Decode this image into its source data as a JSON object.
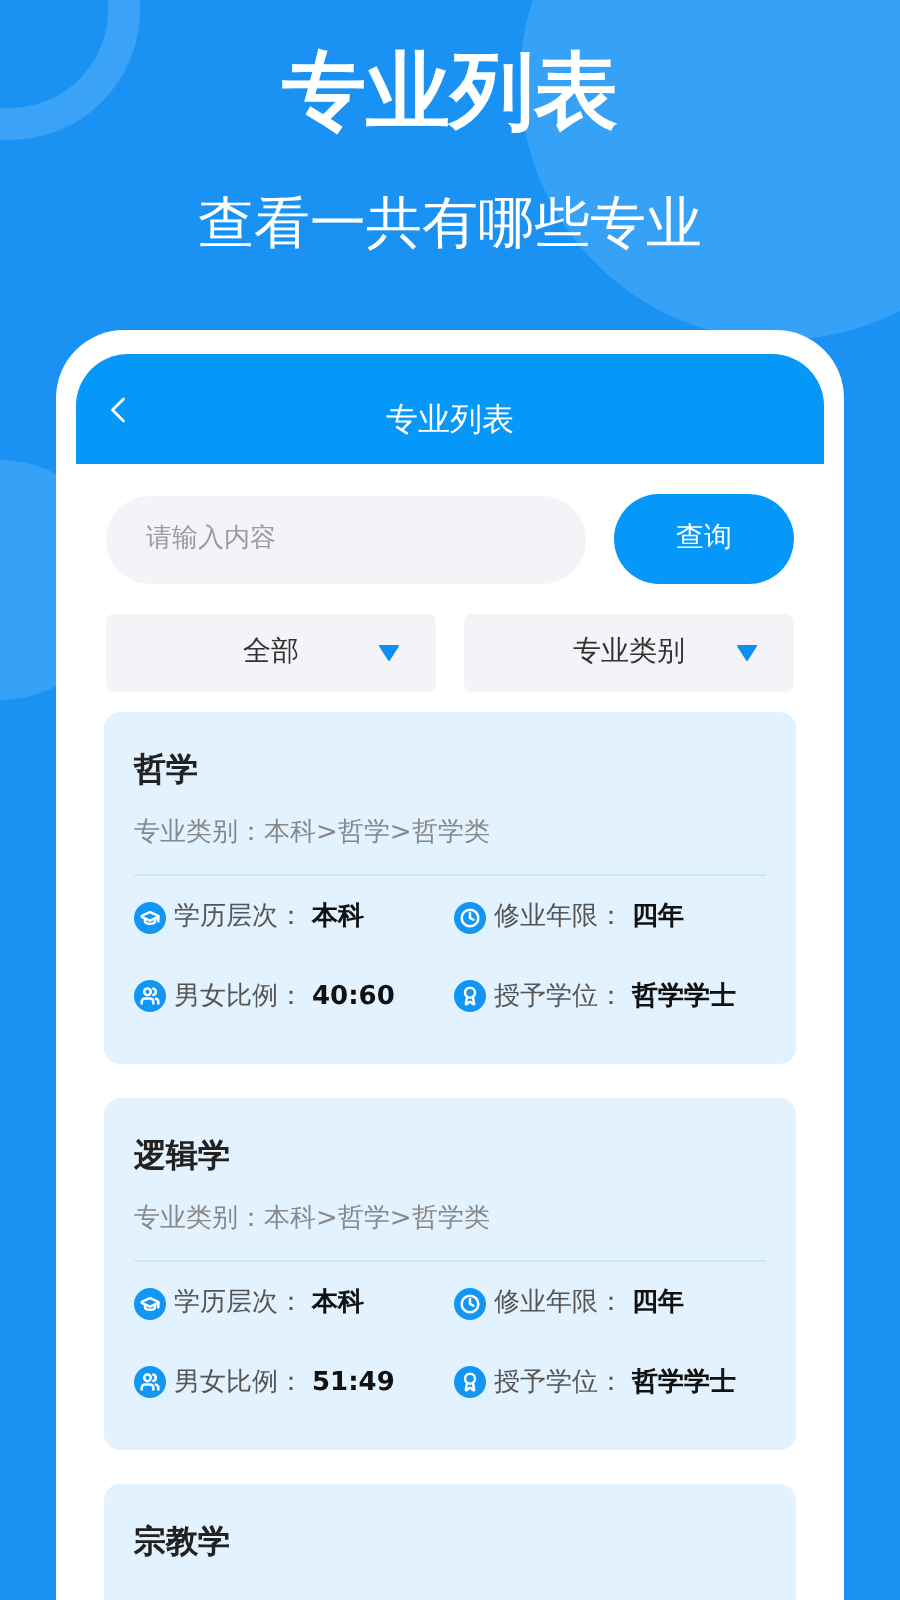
{
  "headline": "专业列表",
  "subheadline": "查看一共有哪些专业",
  "screen": {
    "title": "专业列表",
    "search": {
      "placeholder": "请输入内容",
      "button": "查询"
    },
    "filters": [
      "全部",
      "专业类别"
    ],
    "majors": [
      {
        "name": "哲学",
        "category": "专业类别：本科>哲学>哲学类",
        "fields": [
          {
            "kind": "level",
            "label": "学历层次：",
            "value": "本科"
          },
          {
            "kind": "duration",
            "label": "修业年限：",
            "value": "四年"
          },
          {
            "kind": "ratio",
            "label": "男女比例：",
            "value": "40:60"
          },
          {
            "kind": "degree",
            "label": "授予学位：",
            "value": "哲学学士"
          }
        ]
      },
      {
        "name": "逻辑学",
        "category": "专业类别：本科>哲学>哲学类",
        "fields": [
          {
            "kind": "level",
            "label": "学历层次：",
            "value": "本科"
          },
          {
            "kind": "duration",
            "label": "修业年限：",
            "value": "四年"
          },
          {
            "kind": "ratio",
            "label": "男女比例：",
            "value": "51:49"
          },
          {
            "kind": "degree",
            "label": "授予学位：",
            "value": "哲学学士"
          }
        ]
      },
      {
        "name": "宗教学"
      }
    ]
  }
}
